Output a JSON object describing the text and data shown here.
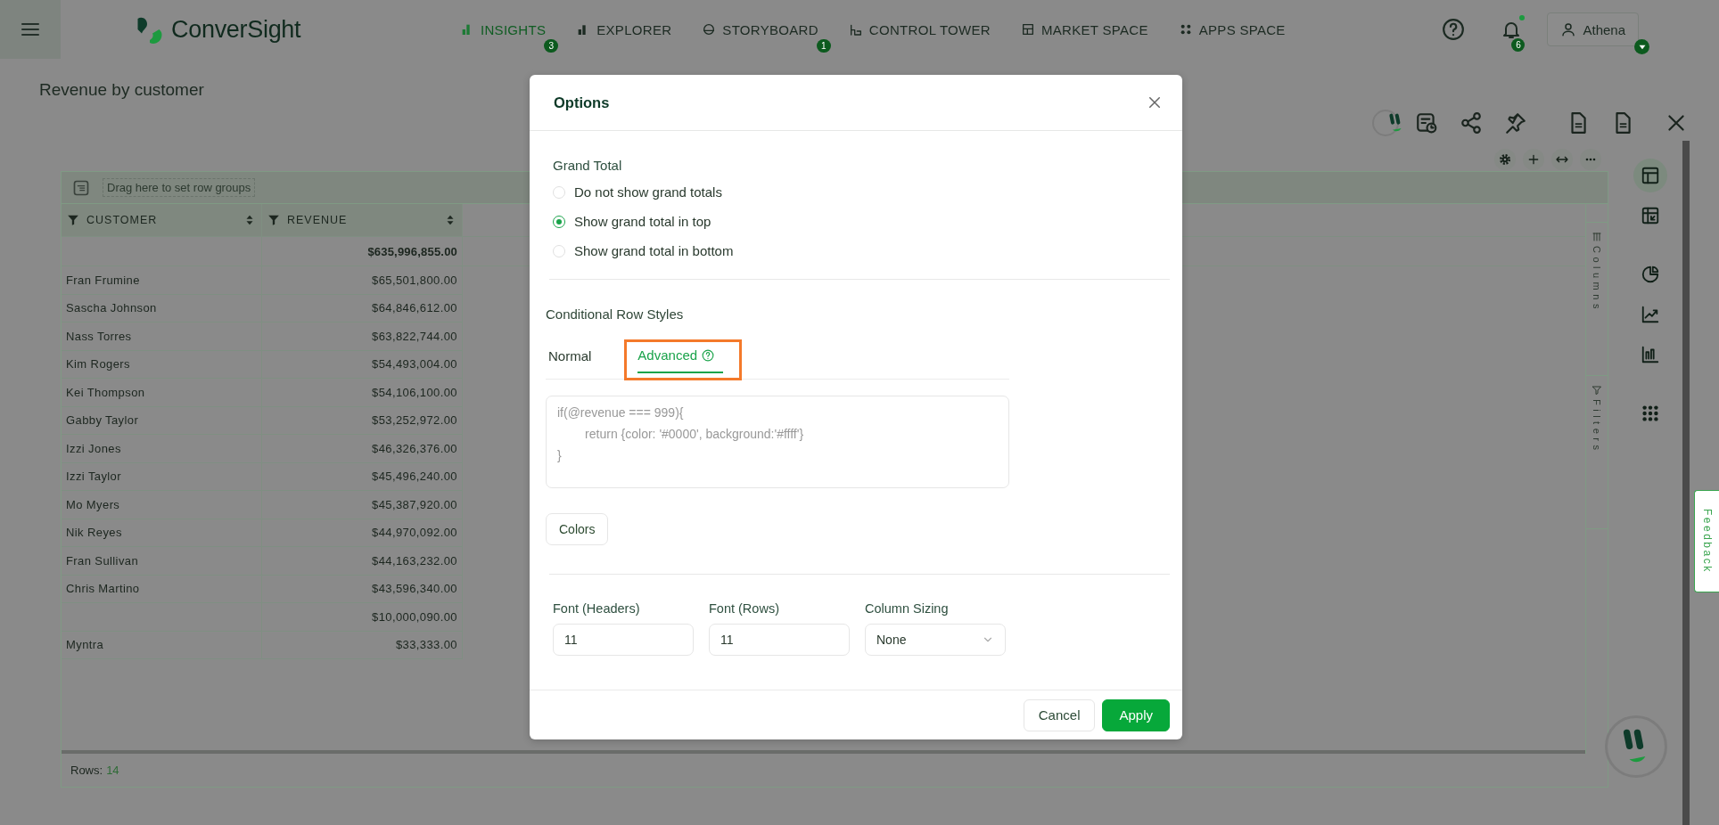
{
  "nav": {
    "brand": "ConverSight",
    "items": [
      {
        "kind": "insights",
        "label": "INSIGHTS",
        "selected": true,
        "badge": "3"
      },
      {
        "kind": "explorer",
        "label": "EXPLORER",
        "selected": false
      },
      {
        "kind": "storyboard",
        "label": "STORYBOARD",
        "selected": false,
        "badge": "1"
      },
      {
        "kind": "tower",
        "label": "CONTROL TOWER",
        "selected": false
      },
      {
        "kind": "market",
        "label": "MARKET SPACE",
        "selected": false
      },
      {
        "kind": "apps",
        "label": "APPS SPACE",
        "selected": false
      }
    ],
    "notifications_badge": "6",
    "user": "Athena"
  },
  "page": {
    "title": "Revenue by customer"
  },
  "table": {
    "group_hint": "Drag here to set row groups",
    "columns": [
      "CUSTOMER",
      "REVENUE"
    ],
    "grand_total": "$635,996,855.00",
    "rows": [
      {
        "customer": "Fran Frumine",
        "revenue": "$65,501,800.00"
      },
      {
        "customer": "Sascha Johnson",
        "revenue": "$64,846,612.00"
      },
      {
        "customer": "Nass Torres",
        "revenue": "$63,822,744.00"
      },
      {
        "customer": "Kim Rogers",
        "revenue": "$54,493,004.00"
      },
      {
        "customer": "Kei Thompson",
        "revenue": "$54,106,100.00"
      },
      {
        "customer": "Gabby Taylor",
        "revenue": "$53,252,972.00"
      },
      {
        "customer": "Izzi Jones",
        "revenue": "$46,326,376.00"
      },
      {
        "customer": "Izzi Taylor",
        "revenue": "$45,496,240.00"
      },
      {
        "customer": "Mo Myers",
        "revenue": "$45,387,920.00"
      },
      {
        "customer": "Nik Reyes",
        "revenue": "$44,970,092.00"
      },
      {
        "customer": "Fran Sullivan",
        "revenue": "$44,163,232.00"
      },
      {
        "customer": "Chris Martino",
        "revenue": "$43,596,340.00"
      },
      {
        "revenue": "$10,000,090.00"
      },
      {
        "customer": "Myntra",
        "revenue": "$33,333.00"
      }
    ],
    "rows_label": "Rows:",
    "rows_count": "14",
    "side_tabs": [
      "Columns",
      "Filters"
    ]
  },
  "view_groups": [
    [
      {
        "kind": "table",
        "selected": true
      },
      {
        "kind": "pivot",
        "selected": false
      }
    ],
    [
      {
        "kind": "pie",
        "selected": false
      },
      {
        "kind": "line",
        "selected": false
      },
      {
        "kind": "bar",
        "selected": false
      }
    ],
    [
      {
        "kind": "apps",
        "selected": false
      }
    ]
  ],
  "feedback": "Feedback",
  "dialog": {
    "title": "Options",
    "grand_total_label": "Grand Total",
    "radios": [
      {
        "label": "Do not show grand totals",
        "selected": false
      },
      {
        "label": "Show grand total in top",
        "selected": true
      },
      {
        "label": "Show grand total in bottom",
        "selected": false
      }
    ],
    "styles_label": "Conditional Row Styles",
    "tabs": [
      {
        "label": "Normal",
        "selected": false,
        "help": false,
        "highlighted": false
      },
      {
        "label": "Advanced",
        "selected": true,
        "help": true,
        "highlighted": true
      }
    ],
    "code_placeholder": "if(@revenue === 999){\n        return {color: '#0000', background:'#ffff'}\n}",
    "colors_button": "Colors",
    "fields": [
      {
        "kind": "input",
        "label": "Font (Headers)",
        "value": "11"
      },
      {
        "kind": "input",
        "label": "Font (Rows)",
        "value": "11"
      },
      {
        "kind": "select",
        "label": "Column Sizing",
        "value": "None"
      }
    ],
    "buttons": [
      {
        "kind": "secondary",
        "label": "Cancel"
      },
      {
        "kind": "primary",
        "label": "Apply"
      }
    ]
  }
}
